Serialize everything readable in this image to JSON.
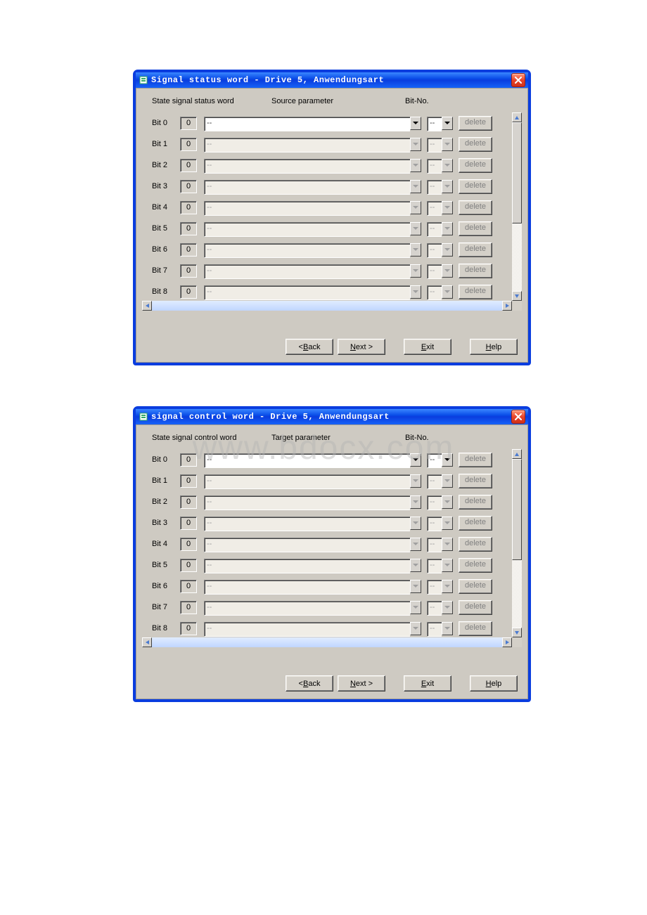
{
  "watermark": "www.bdocx.com",
  "dialogs": [
    {
      "title": "Signal status word - Drive 5,  Anwendungsart",
      "headers": {
        "state": "State signal status word",
        "param": "Source parameter",
        "bitno": "Bit-No."
      },
      "rows": [
        {
          "label": "Bit 0",
          "state": "0",
          "param": "--",
          "bit": "--",
          "enabled": true
        },
        {
          "label": "Bit 1",
          "state": "0",
          "param": "--",
          "bit": "--",
          "enabled": false
        },
        {
          "label": "Bit 2",
          "state": "0",
          "param": "--",
          "bit": "--",
          "enabled": false
        },
        {
          "label": "Bit 3",
          "state": "0",
          "param": "--",
          "bit": "--",
          "enabled": false
        },
        {
          "label": "Bit 4",
          "state": "0",
          "param": "--",
          "bit": "--",
          "enabled": false
        },
        {
          "label": "Bit 5",
          "state": "0",
          "param": "--",
          "bit": "--",
          "enabled": false
        },
        {
          "label": "Bit 6",
          "state": "0",
          "param": "--",
          "bit": "--",
          "enabled": false
        },
        {
          "label": "Bit 7",
          "state": "0",
          "param": "--",
          "bit": "--",
          "enabled": false
        },
        {
          "label": "Bit 8",
          "state": "0",
          "param": "--",
          "bit": "--",
          "enabled": false
        }
      ],
      "buttons": {
        "back": "< Back",
        "next": "Next >",
        "exit": "Exit",
        "help": "Help",
        "delete": "delete"
      }
    },
    {
      "title": "signal control word - Drive 5,  Anwendungsart",
      "headers": {
        "state": "State signal control word",
        "param": "Target parameter",
        "bitno": "Bit-No."
      },
      "rows": [
        {
          "label": "Bit 0",
          "state": "0",
          "param": "--",
          "bit": "--",
          "enabled": true
        },
        {
          "label": "Bit 1",
          "state": "0",
          "param": "--",
          "bit": "--",
          "enabled": false
        },
        {
          "label": "Bit 2",
          "state": "0",
          "param": "--",
          "bit": "--",
          "enabled": false
        },
        {
          "label": "Bit 3",
          "state": "0",
          "param": "--",
          "bit": "--",
          "enabled": false
        },
        {
          "label": "Bit 4",
          "state": "0",
          "param": "--",
          "bit": "--",
          "enabled": false
        },
        {
          "label": "Bit 5",
          "state": "0",
          "param": "--",
          "bit": "--",
          "enabled": false
        },
        {
          "label": "Bit 6",
          "state": "0",
          "param": "--",
          "bit": "--",
          "enabled": false
        },
        {
          "label": "Bit 7",
          "state": "0",
          "param": "--",
          "bit": "--",
          "enabled": false
        },
        {
          "label": "Bit 8",
          "state": "0",
          "param": "--",
          "bit": "--",
          "enabled": false
        }
      ],
      "buttons": {
        "back": "< Back",
        "next": "Next >",
        "exit": "Exit",
        "help": "Help",
        "delete": "delete"
      }
    }
  ]
}
